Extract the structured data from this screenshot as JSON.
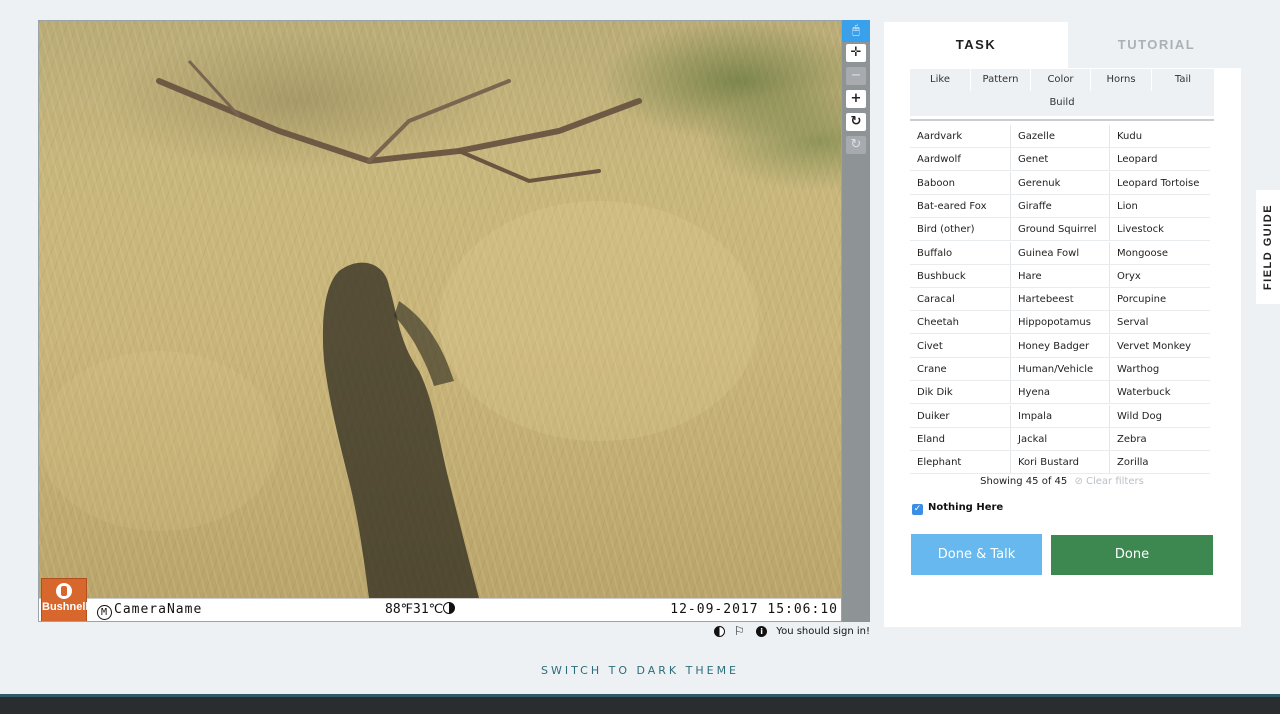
{
  "viewer": {
    "stamp": {
      "logo_text": "Bushnell",
      "camera_name": "CameraName",
      "camera_mark": "M",
      "temperature": "88℉31℃",
      "datetime": "12-09-2017 15:06:10"
    },
    "toolbar": [
      "pointer-icon",
      "move-icon",
      "zoom-out-icon",
      "zoom-in-icon",
      "rotate-icon",
      "reset-icon"
    ]
  },
  "meta": {
    "sign_in_text": "You should sign in!"
  },
  "tabs": {
    "task": "TASK",
    "tutorial": "TUTORIAL"
  },
  "filters": [
    "Like",
    "Pattern",
    "Color",
    "Horns",
    "Tail",
    "Build"
  ],
  "species": [
    [
      "Aardvark",
      "Gazelle",
      "Kudu"
    ],
    [
      "Aardwolf",
      "Genet",
      "Leopard"
    ],
    [
      "Baboon",
      "Gerenuk",
      "Leopard Tortoise"
    ],
    [
      "Bat-eared Fox",
      "Giraffe",
      "Lion"
    ],
    [
      "Bird (other)",
      "Ground Squirrel",
      "Livestock"
    ],
    [
      "Buffalo",
      "Guinea Fowl",
      "Mongoose"
    ],
    [
      "Bushbuck",
      "Hare",
      "Oryx"
    ],
    [
      "Caracal",
      "Hartebeest",
      "Porcupine"
    ],
    [
      "Cheetah",
      "Hippopotamus",
      "Serval"
    ],
    [
      "Civet",
      "Honey Badger",
      "Vervet Monkey"
    ],
    [
      "Crane",
      "Human/Vehicle",
      "Warthog"
    ],
    [
      "Dik Dik",
      "Hyena",
      "Waterbuck"
    ],
    [
      "Duiker",
      "Impala",
      "Wild Dog"
    ],
    [
      "Eland",
      "Jackal",
      "Zebra"
    ],
    [
      "Elephant",
      "Kori Bustard",
      "Zorilla"
    ]
  ],
  "showing": {
    "text": "Showing 45 of 45",
    "clear": "Clear filters"
  },
  "nothing_here": "Nothing Here",
  "buttons": {
    "done_talk": "Done & Talk",
    "done": "Done"
  },
  "field_guide": "FIELD GUIDE",
  "theme_switch": "SWITCH TO DARK THEME",
  "colors": {
    "accent_blue": "#66b8ee",
    "done_green": "#3d8750",
    "toolbar_active": "#3aa0ea",
    "logo_orange": "#d8672e",
    "footer": "#2a2d30"
  }
}
